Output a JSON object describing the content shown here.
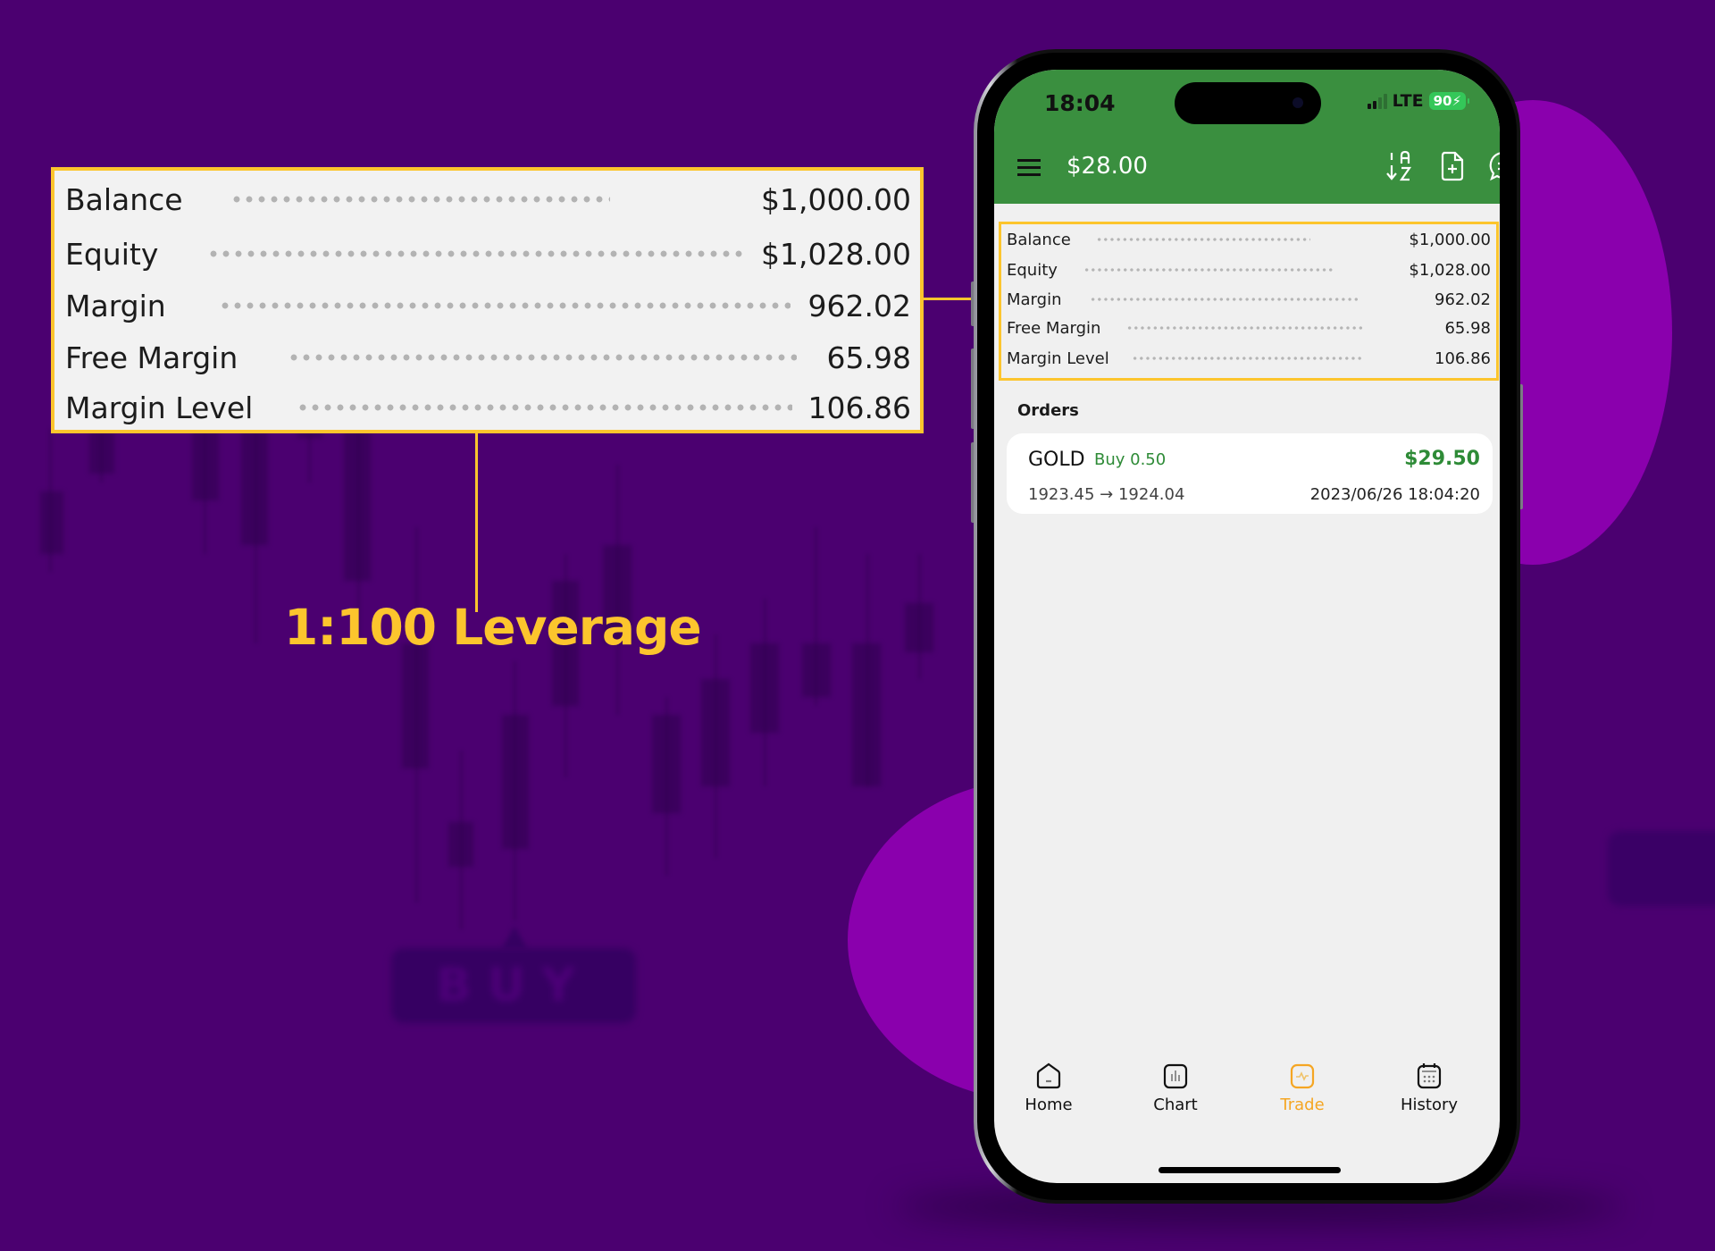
{
  "callout": {
    "rows": [
      {
        "label": "Balance",
        "value": "$1,000.00"
      },
      {
        "label": "Equity",
        "value": "$1,028.00"
      },
      {
        "label": "Margin",
        "value": "962.02"
      },
      {
        "label": "Free Margin",
        "value": "65.98"
      },
      {
        "label": "Margin Level",
        "value": "106.86"
      }
    ],
    "caption": "1:100 Leverage"
  },
  "background": {
    "button_label": "BUY"
  },
  "colors": {
    "background": "#4b0070",
    "accent_blob": "#8a00ad",
    "highlight": "#fcc52d",
    "header_green": "#3a8f3f",
    "profit_green": "#2e8b37",
    "active_tab": "#f5a623"
  },
  "phone": {
    "status_bar": {
      "time": "18:04",
      "network": "LTE",
      "battery": "90",
      "battery_icon": "charging-bolt"
    },
    "header": {
      "menu_icon": "hamburger-icon",
      "amount": "$28.00",
      "actions": [
        {
          "name": "sort-az-icon"
        },
        {
          "name": "new-order-icon"
        },
        {
          "name": "chat-icon"
        }
      ]
    },
    "summary": [
      {
        "label": "Balance",
        "value": "$1,000.00"
      },
      {
        "label": "Equity",
        "value": "$1,028.00"
      },
      {
        "label": "Margin",
        "value": "962.02"
      },
      {
        "label": "Free Margin",
        "value": "65.98"
      },
      {
        "label": "Margin Level",
        "value": "106.86"
      }
    ],
    "orders": {
      "title": "Orders",
      "items": [
        {
          "symbol": "GOLD",
          "side": "Buy 0.50",
          "profit": "$29.50",
          "prices": "1923.45 → 1924.04",
          "time": "2023/06/26 18:04:20"
        }
      ]
    },
    "tabs": [
      {
        "label": "Home",
        "icon": "home-icon",
        "active": false
      },
      {
        "label": "Chart",
        "icon": "chart-icon",
        "active": false
      },
      {
        "label": "Trade",
        "icon": "trade-icon",
        "active": true
      },
      {
        "label": "History",
        "icon": "calendar-icon",
        "active": false
      }
    ]
  }
}
